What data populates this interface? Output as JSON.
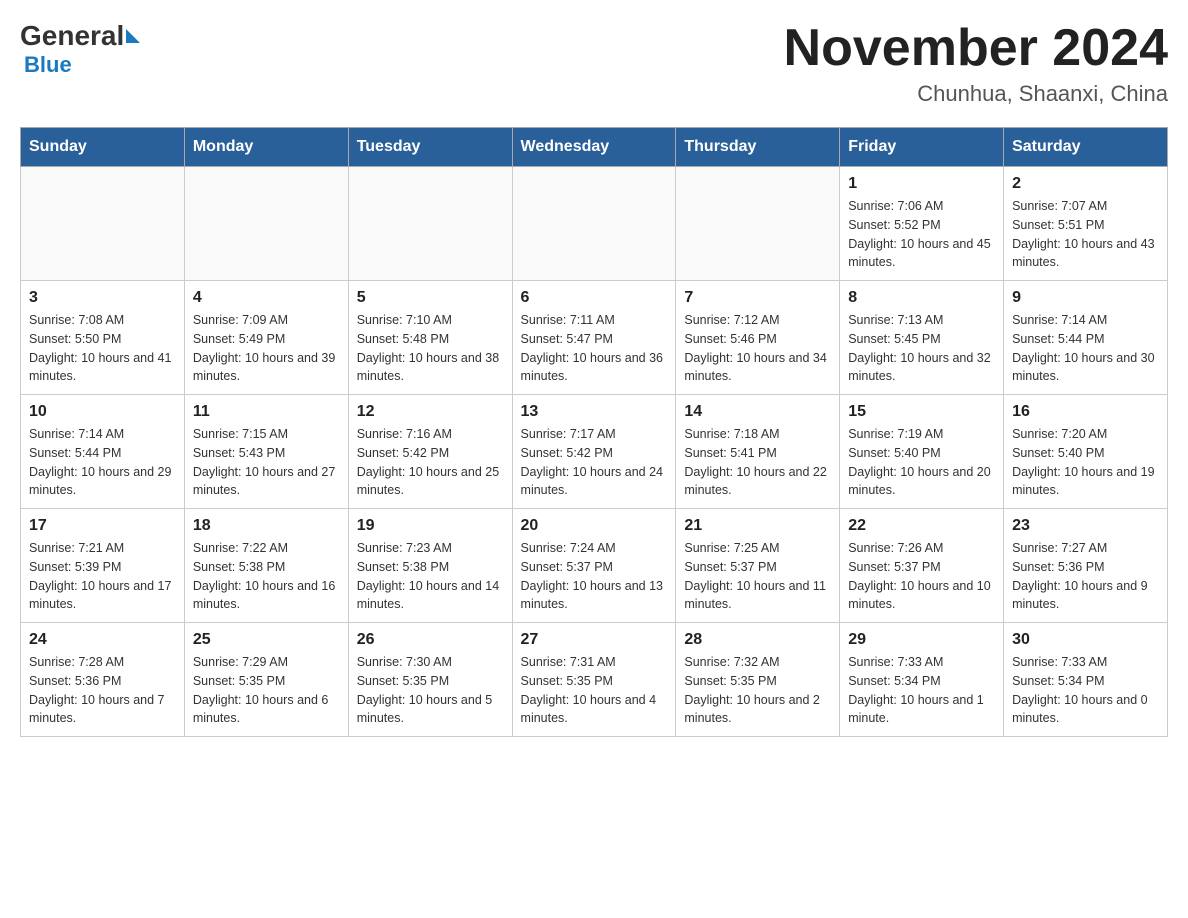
{
  "header": {
    "logo_general": "General",
    "logo_blue": "Blue",
    "title": "November 2024",
    "subtitle": "Chunhua, Shaanxi, China"
  },
  "days_of_week": [
    "Sunday",
    "Monday",
    "Tuesday",
    "Wednesday",
    "Thursday",
    "Friday",
    "Saturday"
  ],
  "weeks": [
    [
      {
        "day": "",
        "info": ""
      },
      {
        "day": "",
        "info": ""
      },
      {
        "day": "",
        "info": ""
      },
      {
        "day": "",
        "info": ""
      },
      {
        "day": "",
        "info": ""
      },
      {
        "day": "1",
        "info": "Sunrise: 7:06 AM\nSunset: 5:52 PM\nDaylight: 10 hours and 45 minutes."
      },
      {
        "day": "2",
        "info": "Sunrise: 7:07 AM\nSunset: 5:51 PM\nDaylight: 10 hours and 43 minutes."
      }
    ],
    [
      {
        "day": "3",
        "info": "Sunrise: 7:08 AM\nSunset: 5:50 PM\nDaylight: 10 hours and 41 minutes."
      },
      {
        "day": "4",
        "info": "Sunrise: 7:09 AM\nSunset: 5:49 PM\nDaylight: 10 hours and 39 minutes."
      },
      {
        "day": "5",
        "info": "Sunrise: 7:10 AM\nSunset: 5:48 PM\nDaylight: 10 hours and 38 minutes."
      },
      {
        "day": "6",
        "info": "Sunrise: 7:11 AM\nSunset: 5:47 PM\nDaylight: 10 hours and 36 minutes."
      },
      {
        "day": "7",
        "info": "Sunrise: 7:12 AM\nSunset: 5:46 PM\nDaylight: 10 hours and 34 minutes."
      },
      {
        "day": "8",
        "info": "Sunrise: 7:13 AM\nSunset: 5:45 PM\nDaylight: 10 hours and 32 minutes."
      },
      {
        "day": "9",
        "info": "Sunrise: 7:14 AM\nSunset: 5:44 PM\nDaylight: 10 hours and 30 minutes."
      }
    ],
    [
      {
        "day": "10",
        "info": "Sunrise: 7:14 AM\nSunset: 5:44 PM\nDaylight: 10 hours and 29 minutes."
      },
      {
        "day": "11",
        "info": "Sunrise: 7:15 AM\nSunset: 5:43 PM\nDaylight: 10 hours and 27 minutes."
      },
      {
        "day": "12",
        "info": "Sunrise: 7:16 AM\nSunset: 5:42 PM\nDaylight: 10 hours and 25 minutes."
      },
      {
        "day": "13",
        "info": "Sunrise: 7:17 AM\nSunset: 5:42 PM\nDaylight: 10 hours and 24 minutes."
      },
      {
        "day": "14",
        "info": "Sunrise: 7:18 AM\nSunset: 5:41 PM\nDaylight: 10 hours and 22 minutes."
      },
      {
        "day": "15",
        "info": "Sunrise: 7:19 AM\nSunset: 5:40 PM\nDaylight: 10 hours and 20 minutes."
      },
      {
        "day": "16",
        "info": "Sunrise: 7:20 AM\nSunset: 5:40 PM\nDaylight: 10 hours and 19 minutes."
      }
    ],
    [
      {
        "day": "17",
        "info": "Sunrise: 7:21 AM\nSunset: 5:39 PM\nDaylight: 10 hours and 17 minutes."
      },
      {
        "day": "18",
        "info": "Sunrise: 7:22 AM\nSunset: 5:38 PM\nDaylight: 10 hours and 16 minutes."
      },
      {
        "day": "19",
        "info": "Sunrise: 7:23 AM\nSunset: 5:38 PM\nDaylight: 10 hours and 14 minutes."
      },
      {
        "day": "20",
        "info": "Sunrise: 7:24 AM\nSunset: 5:37 PM\nDaylight: 10 hours and 13 minutes."
      },
      {
        "day": "21",
        "info": "Sunrise: 7:25 AM\nSunset: 5:37 PM\nDaylight: 10 hours and 11 minutes."
      },
      {
        "day": "22",
        "info": "Sunrise: 7:26 AM\nSunset: 5:37 PM\nDaylight: 10 hours and 10 minutes."
      },
      {
        "day": "23",
        "info": "Sunrise: 7:27 AM\nSunset: 5:36 PM\nDaylight: 10 hours and 9 minutes."
      }
    ],
    [
      {
        "day": "24",
        "info": "Sunrise: 7:28 AM\nSunset: 5:36 PM\nDaylight: 10 hours and 7 minutes."
      },
      {
        "day": "25",
        "info": "Sunrise: 7:29 AM\nSunset: 5:35 PM\nDaylight: 10 hours and 6 minutes."
      },
      {
        "day": "26",
        "info": "Sunrise: 7:30 AM\nSunset: 5:35 PM\nDaylight: 10 hours and 5 minutes."
      },
      {
        "day": "27",
        "info": "Sunrise: 7:31 AM\nSunset: 5:35 PM\nDaylight: 10 hours and 4 minutes."
      },
      {
        "day": "28",
        "info": "Sunrise: 7:32 AM\nSunset: 5:35 PM\nDaylight: 10 hours and 2 minutes."
      },
      {
        "day": "29",
        "info": "Sunrise: 7:33 AM\nSunset: 5:34 PM\nDaylight: 10 hours and 1 minute."
      },
      {
        "day": "30",
        "info": "Sunrise: 7:33 AM\nSunset: 5:34 PM\nDaylight: 10 hours and 0 minutes."
      }
    ]
  ]
}
